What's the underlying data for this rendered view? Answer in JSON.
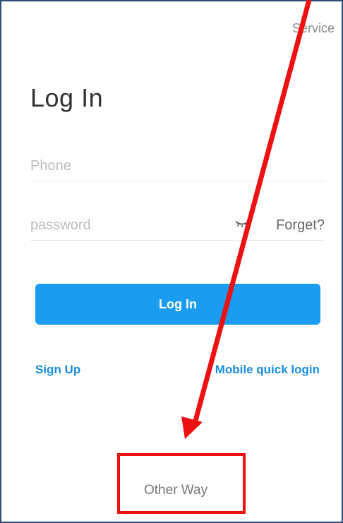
{
  "header": {
    "service_label": "Service"
  },
  "page": {
    "title": "Log In"
  },
  "form": {
    "phone_placeholder": "Phone",
    "password_placeholder": "password",
    "forget_label": "Forget?",
    "login_label": "Log In"
  },
  "links": {
    "signup_label": "Sign Up",
    "quick_login_label": "Mobile quick login"
  },
  "footer": {
    "other_way_label": "Other Way"
  },
  "colors": {
    "accent": "#1a9cf0",
    "link": "#1a8fdb",
    "annotation": "#ee1111"
  }
}
